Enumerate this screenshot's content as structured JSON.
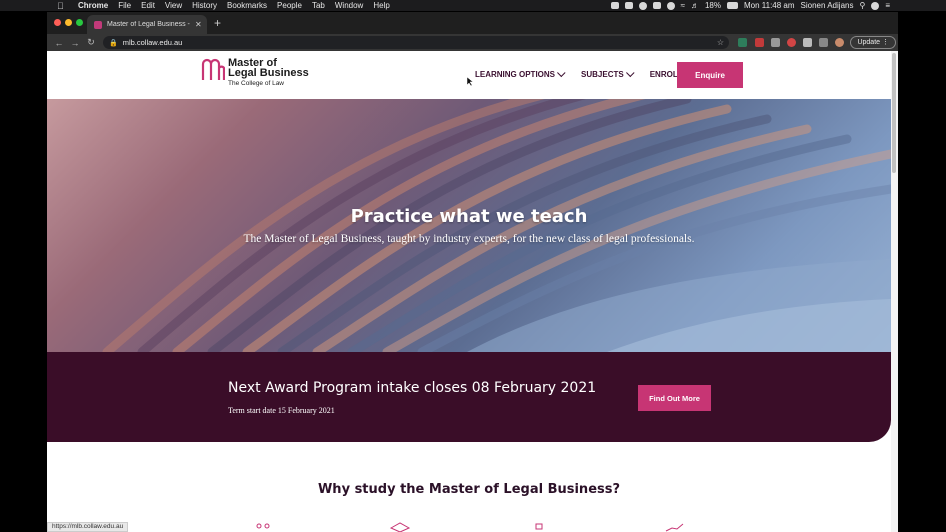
{
  "menubar": {
    "items": [
      "Chrome",
      "File",
      "Edit",
      "View",
      "History",
      "Bookmarks",
      "People",
      "Tab",
      "Window",
      "Help"
    ],
    "battery": "18%",
    "clock": "Mon 11:48 am",
    "user": "Sionen Adijans"
  },
  "browser": {
    "tab_title": "Master of Legal Business - Co",
    "url": "mlb.collaw.edu.au",
    "update_label": "Update",
    "status_url": "https://mlb.collaw.edu.au"
  },
  "site": {
    "logo": {
      "line1": "Master of",
      "line2": "Legal Business",
      "line3": "The College of Law"
    },
    "nav": {
      "learning_options": "LEARNING OPTIONS",
      "subjects": "SUBJECTS",
      "enrol": "ENROL",
      "enquire": "Enquire"
    },
    "hero": {
      "title": "Practice what we teach",
      "subtitle": "The Master of Legal Business, taught by industry experts, for the new class of legal professionals."
    },
    "intake": {
      "title": "Next Award Program intake closes 08 February 2021",
      "sub": "Term start date 15 February 2021",
      "button": "Find Out More"
    },
    "why": {
      "title": "Why study the Master of Legal Business?"
    }
  },
  "colors": {
    "brand_pink": "#c73574",
    "brand_plum": "#3a0d28"
  }
}
